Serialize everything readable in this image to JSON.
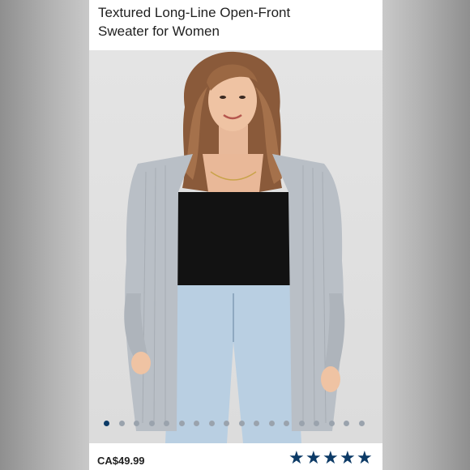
{
  "product": {
    "title_line1": "Textured Long-Line Open-Front",
    "title_line2": "Sweater for Women",
    "price": "CA$49.99",
    "rating_stars": 5
  },
  "gallery": {
    "image_count": 18,
    "active_index": 0
  },
  "colors": {
    "accent": "#0c3a66",
    "dot_inactive": "#9aa3ad",
    "background": "#ffffff"
  },
  "icons": {
    "star": "star-icon"
  }
}
